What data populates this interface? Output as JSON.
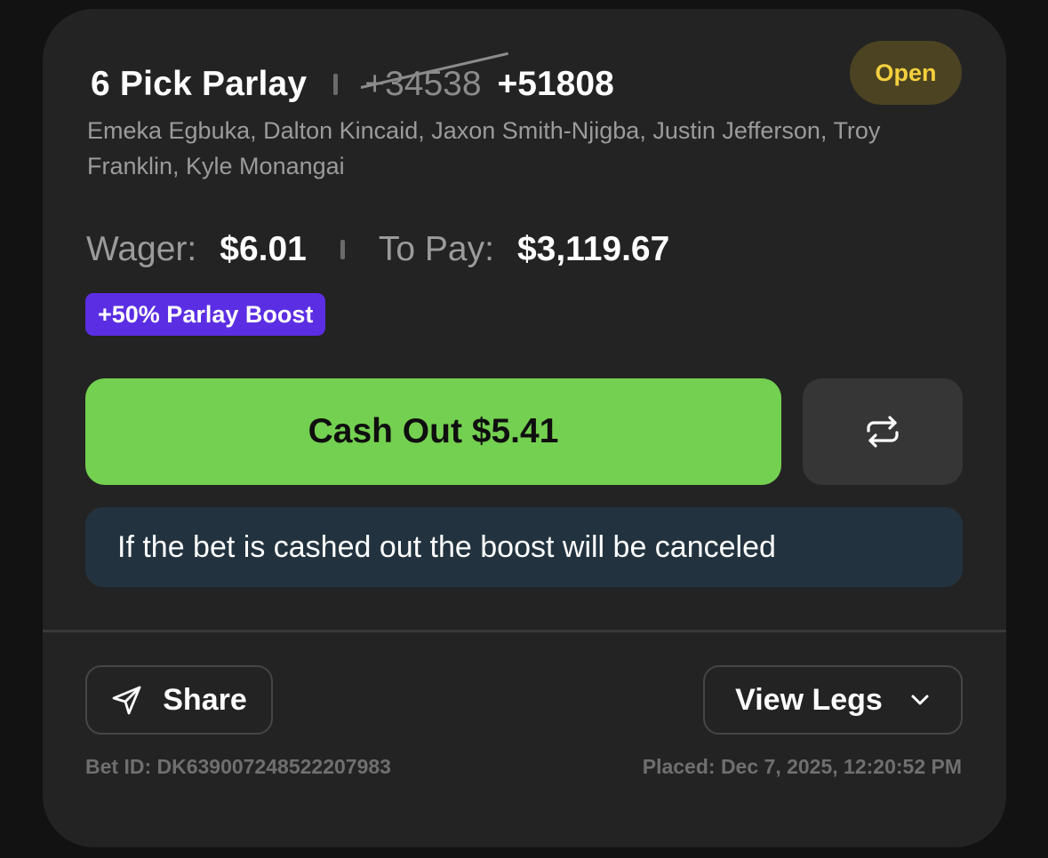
{
  "bet": {
    "title": "6 Pick Parlay",
    "original_odds": "+34538",
    "boosted_odds": "+51808",
    "status": "Open",
    "players": "Emeka Egbuka, Dalton Kincaid, Jaxon Smith-Njigba, Justin Jefferson, Troy Franklin, Kyle Monangai",
    "wager_label": "Wager:",
    "wager_value": "$6.01",
    "to_pay_label": "To Pay:",
    "to_pay_value": "$3,119.67",
    "boost_label": "+50% Parlay Boost",
    "bet_id": "Bet ID: DK639007248522207983",
    "placed": "Placed: Dec 7, 2025, 12:20:52 PM"
  },
  "actions": {
    "cashout_label": "Cash Out $5.41",
    "notice": "If the bet is cashed out the boost will be canceled",
    "share_label": "Share",
    "view_legs_label": "View Legs"
  },
  "icons": {
    "repeat": "repeat-icon",
    "share": "send-icon",
    "expand": "chevron-down-icon"
  },
  "colors": {
    "card_bg": "#232323",
    "status_text": "#f4cf3e",
    "status_bg": "#4b4322",
    "boost_bg": "#5b2ee3",
    "cashout_bg": "#74d050",
    "notice_bg": "#22333f"
  }
}
